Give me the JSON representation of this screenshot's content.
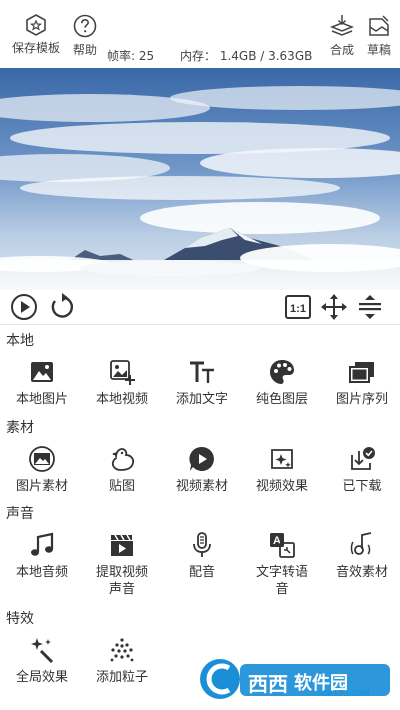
{
  "topbar": {
    "save_template": "保存模板",
    "help": "帮助",
    "fps": "帧率: 25",
    "memory": "内存： 1.4GB / 3.63GB",
    "compose": "合成",
    "draft": "草稿"
  },
  "sections": [
    {
      "title": "本地",
      "items": [
        "本地图片",
        "本地视频",
        "添加文字",
        "纯色图层",
        "图片序列"
      ]
    },
    {
      "title": "素材",
      "items": [
        "图片素材",
        "贴图",
        "视频素材",
        "视频效果",
        "已下载"
      ]
    },
    {
      "title": "声音",
      "items": [
        "本地音频",
        "提取视频声音",
        "配音",
        "文字转语音",
        "音效素材"
      ]
    },
    {
      "title": "特效",
      "items": [
        "全局效果",
        "添加粒子"
      ]
    }
  ],
  "watermark": {
    "brand": "西西",
    "suffix": "软件园",
    "url": "CR173.COM"
  },
  "colors": {
    "accent": "#333333",
    "sky": "#3f6fb0",
    "watermark": "#1a8fd8"
  }
}
